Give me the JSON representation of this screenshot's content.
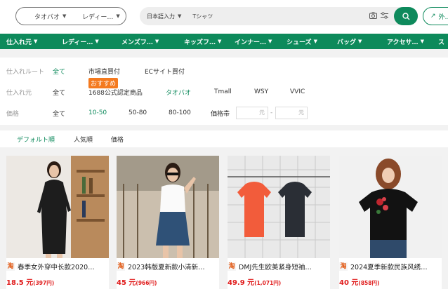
{
  "header": {
    "source_select": "タオバオ",
    "category_select": "レディー…",
    "language_select": "日本語入力",
    "search_value": "Tシャツ",
    "external_button": "外…"
  },
  "nav": {
    "items": [
      "仕入れ元",
      "レディー…",
      "メンズフ…",
      "キッズフ…",
      "インナー…",
      "シューズ",
      "バッグ",
      "アクセサ…",
      "ス"
    ]
  },
  "filters": {
    "row1": {
      "label": "仕入れルート",
      "options": [
        "全て",
        "市場直買付",
        "ECサイト買付"
      ]
    },
    "row2": {
      "label": "仕入れ元",
      "options": [
        "全て",
        "1688公式認定商品",
        "タオバオ",
        "Tmall",
        "WSY",
        "VVIC"
      ],
      "badge": "おすすめ"
    },
    "row3": {
      "label": "価格",
      "options": [
        "全て",
        "10-50",
        "50-80",
        "80-100"
      ],
      "range_label": "価格帯",
      "unit1": "元",
      "unit2": "元",
      "dash": "-"
    }
  },
  "sort": {
    "options": [
      "デフォルト順",
      "人気順",
      "価格"
    ]
  },
  "products": [
    {
      "title": "春季女外穿中长款2020…",
      "price": "18.5 元",
      "price_jpy": "(397円)"
    },
    {
      "title": "2023韩版夏新款小清新…",
      "price": "45 元",
      "price_jpy": "(966円)"
    },
    {
      "title": "DMJ先生欧美紧身短袖…",
      "price": "49.9 元",
      "price_jpy": "(1,071円)"
    },
    {
      "title": "2024夏季新款民族风绣…",
      "price": "40 元",
      "price_jpy": "(858円)"
    }
  ],
  "colors": {
    "accent": "#0d8a5b",
    "price": "#e01b1b",
    "badge": "#f47a1f"
  }
}
